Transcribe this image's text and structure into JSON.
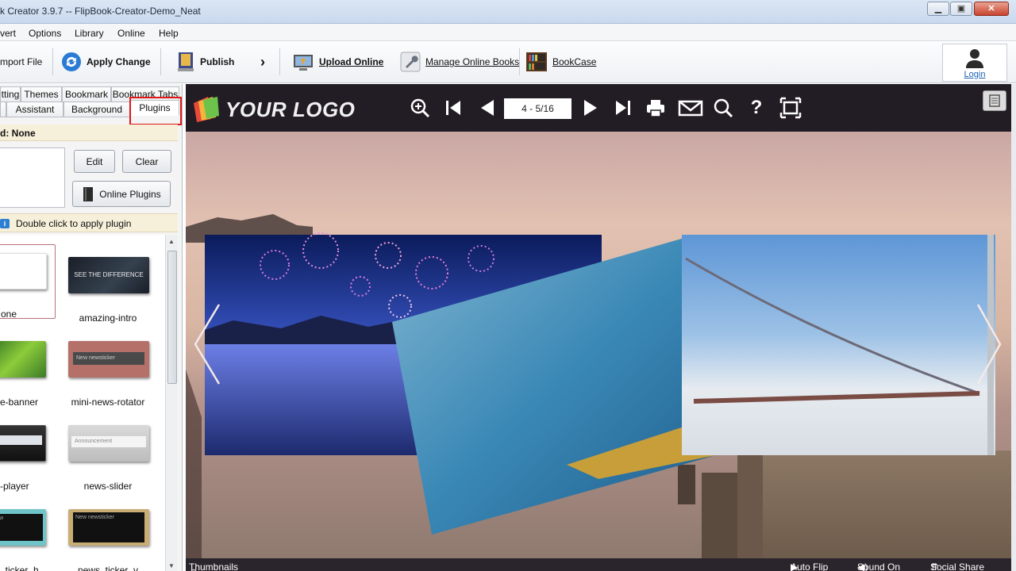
{
  "window": {
    "title": "k Creator 3.9.7  -- FlipBook-Creator-Demo_Neat",
    "controls": {
      "minimize": "▁",
      "maximize": "▣",
      "close": "✕"
    }
  },
  "menu": [
    "vert",
    "Options",
    "Library",
    "Online",
    "Help"
  ],
  "toolbar": {
    "import": "mport File",
    "apply_change": "Apply Change",
    "publish": "Publish",
    "upload_online": "Upload Online",
    "manage_online_books": "Manage Online Books",
    "bookcase": "BookCase",
    "login": "Login"
  },
  "left_panel": {
    "tabs_row1": [
      "tting",
      "Themes",
      "Bookmark",
      "Bookmark Tabs"
    ],
    "tabs_row2": [
      "",
      "Assistant",
      "Background",
      "Plugins"
    ],
    "applied": "d: None",
    "edit": "Edit",
    "clear": "Clear",
    "online_plugins": "Online Plugins",
    "hint": "Double click to apply plugin",
    "plugins": [
      {
        "label": "one",
        "thumb_text": ""
      },
      {
        "label": "amazing-intro",
        "thumb_text": "SEE THE DIFFERENCE"
      },
      {
        "label": "e-banner",
        "thumb_text": ""
      },
      {
        "label": "mini-news-rotator",
        "thumb_text": "New newsticker"
      },
      {
        "label": "-player",
        "thumb_text": ""
      },
      {
        "label": "news-slider",
        "thumb_text": "Announcement"
      },
      {
        "label": "_ticker_h",
        "thumb_text": "New"
      },
      {
        "label": "news_ticker_v",
        "thumb_text": "New newsticker"
      }
    ]
  },
  "viewer": {
    "logo": "YOUR LOGO",
    "page_indicator": "4 - 5/16",
    "bottom": {
      "thumbnails": "Thumbnails",
      "auto_flip": "Auto Flip",
      "sound_on": "Sound On",
      "social_share": "Social Share"
    }
  },
  "colors": {
    "highlight": "#e01818",
    "viewer_bar": "#221d25",
    "link": "#1a5fb4"
  }
}
